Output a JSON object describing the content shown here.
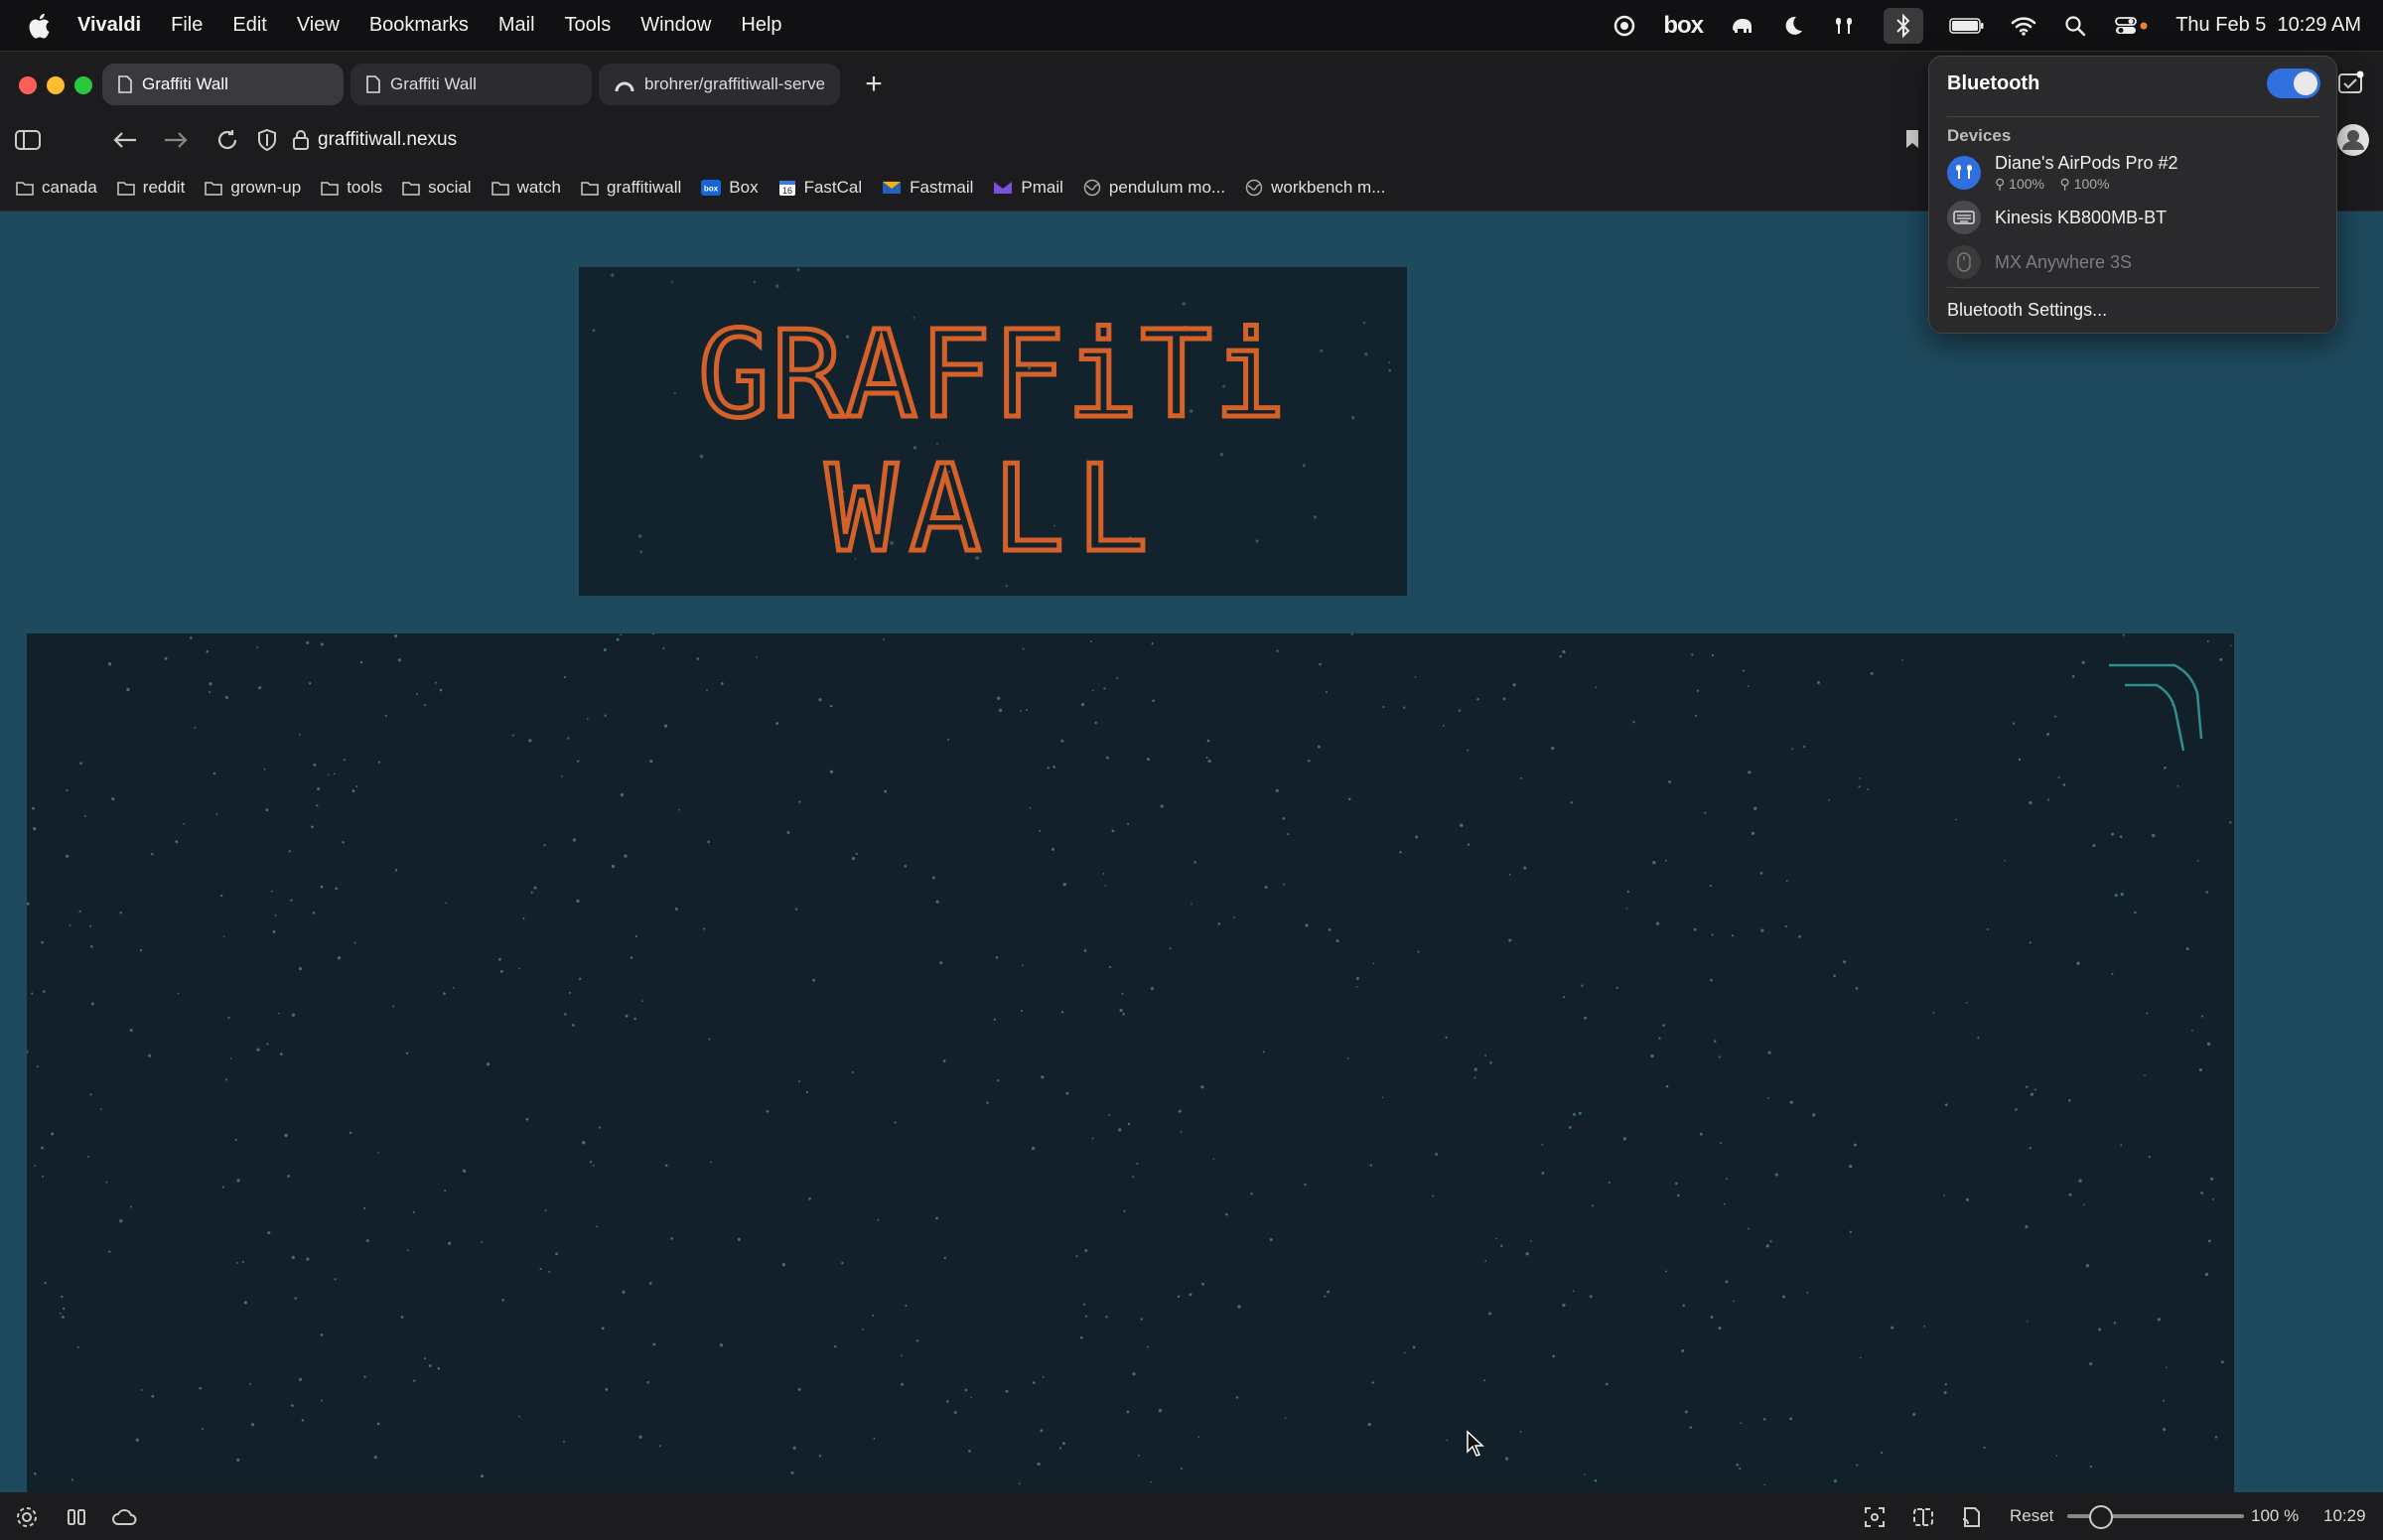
{
  "menubar": {
    "app_name": "Vivaldi",
    "items": [
      "File",
      "Edit",
      "View",
      "Bookmarks",
      "Mail",
      "Tools",
      "Window",
      "Help"
    ],
    "status_icons": [
      "record-icon",
      "box-icon",
      "elephant-icon",
      "moon-icon",
      "airpods-icon",
      "bluetooth-icon",
      "battery-icon",
      "wifi-icon",
      "search-icon",
      "control-center-icon"
    ],
    "box_label": "box",
    "clock": "Thu Feb 5  10:29 AM"
  },
  "tabs": [
    {
      "label": "Graffiti Wall",
      "icon": "page-icon",
      "active": true
    },
    {
      "label": "Graffiti Wall",
      "icon": "page-icon",
      "active": false
    },
    {
      "label": "brohrer/graffitiwall-server",
      "icon": "arc-icon",
      "active": false
    }
  ],
  "new_tab_label": "+",
  "address": {
    "url": "graffitiwall.nexus"
  },
  "bookmarks": [
    {
      "label": "canada",
      "icon": "folder-icon"
    },
    {
      "label": "reddit",
      "icon": "folder-icon"
    },
    {
      "label": "grown-up",
      "icon": "folder-icon"
    },
    {
      "label": "tools",
      "icon": "folder-icon"
    },
    {
      "label": "social",
      "icon": "folder-icon"
    },
    {
      "label": "watch",
      "icon": "folder-icon"
    },
    {
      "label": "graffitiwall",
      "icon": "folder-icon"
    },
    {
      "label": "Box",
      "icon": "box-favicon"
    },
    {
      "label": "FastCal",
      "icon": "calendar-favicon"
    },
    {
      "label": "Fastmail",
      "icon": "fastmail-favicon"
    },
    {
      "label": "Pmail",
      "icon": "pmail-favicon"
    },
    {
      "label": "pendulum mo...",
      "icon": "globe-icon"
    },
    {
      "label": "workbench m...",
      "icon": "globe-icon"
    }
  ],
  "page": {
    "logo_text": [
      "GRAFFiTi",
      "WALL"
    ],
    "logo_color": "#d4602a",
    "background_color": "#1f4a5e",
    "canvas_color": "#122029"
  },
  "bluetooth": {
    "title": "Bluetooth",
    "enabled": true,
    "devices_label": "Devices",
    "devices": [
      {
        "name": "Diane's AirPods Pro #2",
        "left": "100%",
        "right": "100%",
        "icon": "airpods-icon",
        "connected": true
      },
      {
        "name": "Kinesis KB800MB-BT",
        "icon": "keyboard-icon",
        "connected": false
      },
      {
        "name": "MX Anywhere 3S",
        "icon": "mouse-icon",
        "connected": false,
        "dimmed": true
      }
    ],
    "settings_label": "Bluetooth Settings..."
  },
  "statusbar": {
    "reset_label": "Reset",
    "zoom": "100 %",
    "time": "10:29"
  }
}
